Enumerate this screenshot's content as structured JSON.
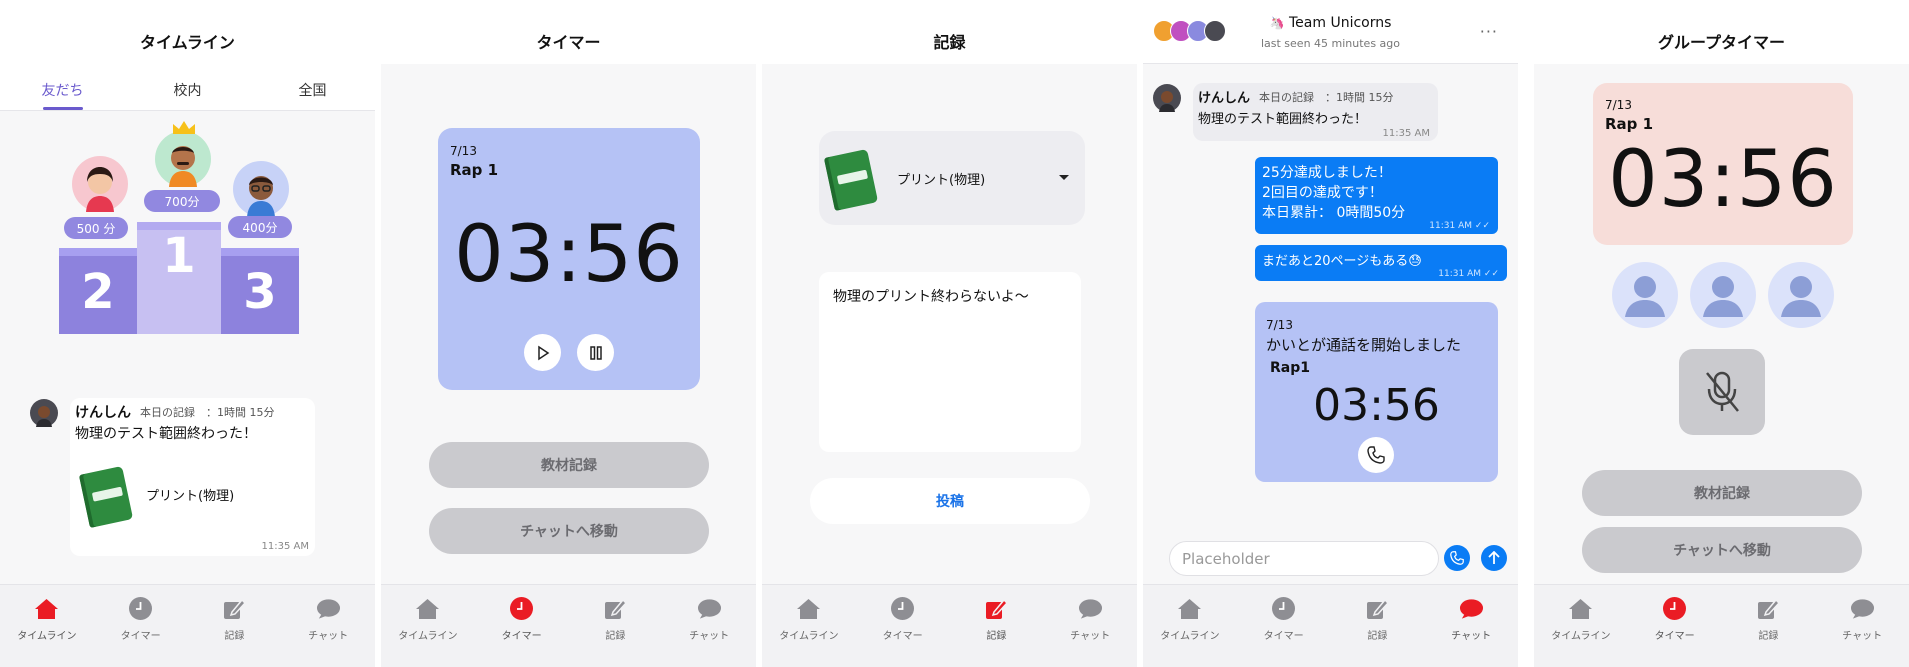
{
  "tabbar": [
    {
      "label": "タイムライン",
      "icon": "home-icon"
    },
    {
      "label": "タイマー",
      "icon": "clock-icon"
    },
    {
      "label": "記録",
      "icon": "edit-icon"
    },
    {
      "label": "チャット",
      "icon": "chat-bubble-icon"
    }
  ],
  "colors": {
    "accent": "#ea1c24",
    "purple": "#6a5acd",
    "card_blue": "#b5c2f5",
    "bubble_blue": "#0a7cf5",
    "pink_card": "#f7ddd9"
  },
  "timeline": {
    "title": "タイムライン",
    "tabs": [
      "友だち",
      "校内",
      "全国"
    ],
    "podium": [
      {
        "rank": "2",
        "points": "500 分"
      },
      {
        "rank": "1",
        "points": "700分"
      },
      {
        "rank": "3",
        "points": "400分"
      }
    ],
    "post": {
      "name": "けんしん",
      "meta": "本日の記録　：1時間 15分",
      "text": "物理のテスト範囲終わった！",
      "material": "プリント(物理)",
      "time": "11:35 AM"
    }
  },
  "timer": {
    "title": "タイマー",
    "date": "7/13",
    "lap": "Rap 1",
    "time": "03:56",
    "buttons": [
      "教材記録",
      "チャットへ移動"
    ]
  },
  "record": {
    "title": "記録",
    "material": "プリント(物理)",
    "memo": "物理のプリント終わらないよ〜",
    "post_button": "投稿"
  },
  "chat": {
    "group_name": "Team Unicorns",
    "group_emoji": "🦄",
    "last_seen": "last seen 45 minutes ago",
    "in_name": "けんしん",
    "in_meta": "本日の記録　：1時間 15分",
    "in_text": "物理のテスト範囲終わった！",
    "in_time": "11:35 AM",
    "out1_lines": [
      "25分達成しました！",
      "2回目の達成です！",
      "本日累計：  0時間50分"
    ],
    "out1_time": "11:31 AM",
    "out2_text": "まだあと20ページもある😓",
    "out2_time": "11:31 AM",
    "call_date": "7/13",
    "call_text": "かいとが通話を開始しました",
    "call_lap": "Rap1",
    "call_time": "03:56",
    "input_placeholder": "Placeholder"
  },
  "group": {
    "title": "グループタイマー",
    "date": "7/13",
    "lap": "Rap 1",
    "time": "03:56",
    "buttons": [
      "教材記録",
      "チャットへ移動"
    ]
  }
}
